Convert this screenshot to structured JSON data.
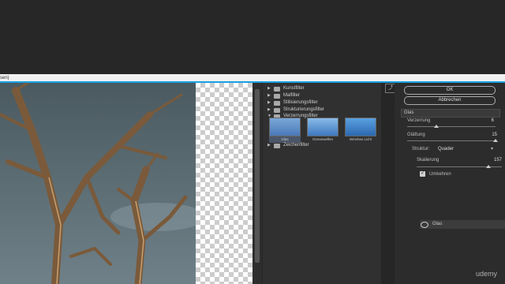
{
  "window": {
    "title_fragment": "sen)"
  },
  "filter_categories": [
    {
      "label": "Kunstfilter",
      "expanded": false
    },
    {
      "label": "Malfilter",
      "expanded": false
    },
    {
      "label": "Stilisierungsfilter",
      "expanded": false
    },
    {
      "label": "Strukturierungsfilter",
      "expanded": false
    },
    {
      "label": "Verzerrungsfilter",
      "expanded": true
    },
    {
      "label": "Zeichenfilter",
      "expanded": false
    }
  ],
  "thumbnails": [
    {
      "label": "Glas",
      "selected": true
    },
    {
      "label": "Ozeanwellen",
      "selected": false
    },
    {
      "label": "Weiches Licht",
      "selected": false
    }
  ],
  "buttons": {
    "ok": "OK",
    "cancel": "Abbrechen"
  },
  "filter_select": {
    "value": "Glas"
  },
  "params": {
    "verzerrung": {
      "label": "Verzerrung",
      "value": "6"
    },
    "glaettung": {
      "label": "Glättung",
      "value": "15"
    },
    "struktur": {
      "label": "Struktur:",
      "value": "Quader"
    },
    "skalierung": {
      "label": "Skalierung",
      "value": "157"
    },
    "umkehren": {
      "label": "Umkehren",
      "checked": true
    }
  },
  "layer": {
    "label": "Glas"
  },
  "watermark": "udemy",
  "colors": {
    "accent": "#1aa1e4",
    "panel": "#2c2c2c"
  }
}
